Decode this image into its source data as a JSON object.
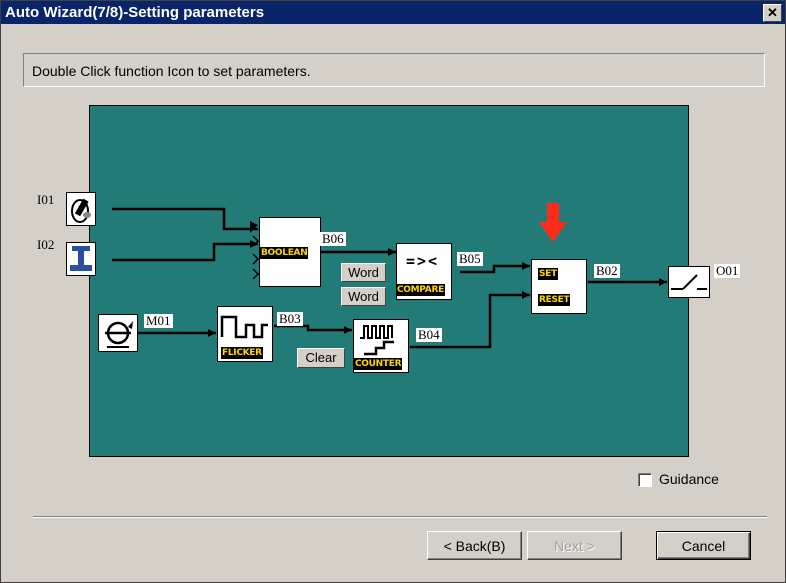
{
  "window": {
    "title": "Auto Wizard(7/8)-Setting parameters",
    "close_glyph": "✕"
  },
  "instruction": "Double Click function Icon to set parameters.",
  "diagram": {
    "inputs": [
      "I01",
      "I02",
      "M01"
    ],
    "blocks": {
      "boolean": {
        "label": "BOOLEAN",
        "output": "B06"
      },
      "compare": {
        "label": "COMPARE",
        "symbol": "=><",
        "output": "B05",
        "word_buttons": [
          "Word",
          "Word"
        ]
      },
      "flicker": {
        "label": "FLICKER",
        "output": "B03"
      },
      "counter": {
        "label": "COUNTER",
        "output": "B04",
        "clear_button": "Clear"
      },
      "setreset": {
        "set_label": "SET",
        "reset_label": "RESET",
        "output": "B02"
      }
    },
    "output": "O01",
    "accent_arrow_color": "#ff2a1a",
    "background_color": "#237b78"
  },
  "guidance": {
    "label": "Guidance",
    "checked": false
  },
  "buttons": {
    "back": "< Back(B)",
    "next": "Next >",
    "cancel": "Cancel"
  }
}
